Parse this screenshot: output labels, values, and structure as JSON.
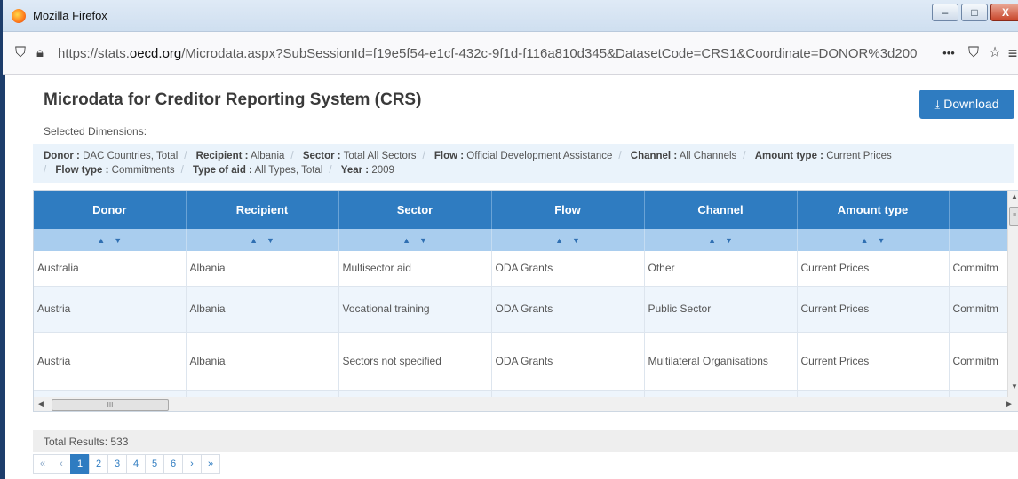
{
  "window": {
    "title": "Mozilla Firefox",
    "minimize": "–",
    "maximize": "□",
    "close": "X"
  },
  "nav": {
    "url_prefix": "https://stats.",
    "url_domain": "oecd.org",
    "url_rest": "/Microdata.aspx?SubSessionId=f19e5f54-e1cf-432c-9f1d-f116a810d345&DatasetCode=CRS1&Coordinate=DONOR%3d200",
    "more": "•••",
    "pocket": "⛉",
    "star": "☆",
    "menu": "≡"
  },
  "page": {
    "title": "Microdata for Creditor Reporting System (CRS)",
    "download_label": "Download",
    "selected_dimensions_label": "Selected Dimensions:"
  },
  "dimensions": [
    {
      "key": "Donor :",
      "value": "DAC Countries, Total"
    },
    {
      "key": "Recipient :",
      "value": "Albania"
    },
    {
      "key": "Sector :",
      "value": "Total All Sectors"
    },
    {
      "key": "Flow :",
      "value": "Official Development Assistance"
    },
    {
      "key": "Channel :",
      "value": "All Channels"
    },
    {
      "key": "Amount type :",
      "value": "Current Prices"
    },
    {
      "key": "Flow type :",
      "value": "Commitments"
    },
    {
      "key": "Type of aid :",
      "value": "All Types, Total"
    },
    {
      "key": "Year :",
      "value": "2009"
    }
  ],
  "table": {
    "columns": [
      "Donor",
      "Recipient",
      "Sector",
      "Flow",
      "Channel",
      "Amount type",
      ""
    ],
    "rows": [
      [
        "Australia",
        "Albania",
        "Multisector aid",
        "ODA Grants",
        "Other",
        "Current Prices",
        "Commitm"
      ],
      [
        "Austria",
        "Albania",
        "Vocational training",
        "ODA Grants",
        "Public Sector",
        "Current Prices",
        "Commitm"
      ],
      [
        "Austria",
        "Albania",
        "Sectors not specified",
        "ODA Grants",
        "Multilateral Organisations",
        "Current Prices",
        "Commitm"
      ]
    ]
  },
  "footer": {
    "total_results": "Total Results: 533"
  },
  "pager": {
    "first": "«",
    "prev": "‹",
    "pages": [
      "1",
      "2",
      "3",
      "4",
      "5",
      "6"
    ],
    "active_page": "1",
    "next": "›",
    "last": "»"
  }
}
